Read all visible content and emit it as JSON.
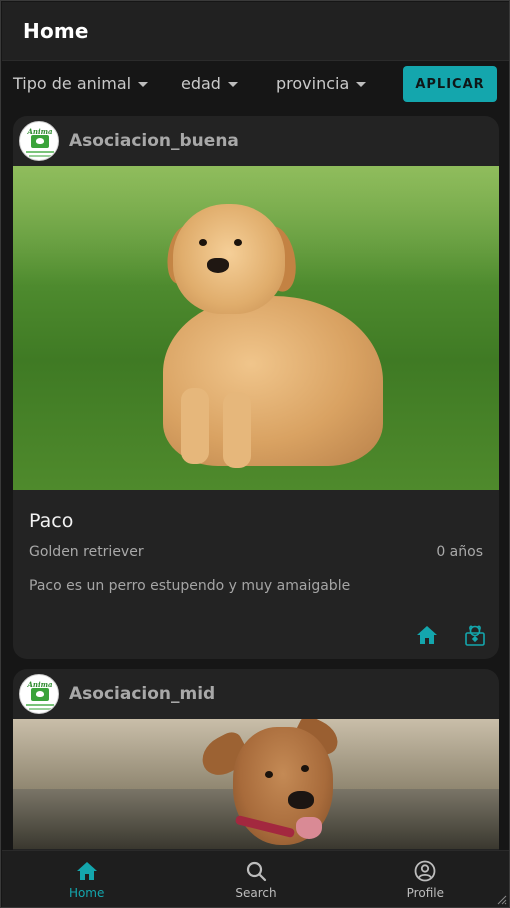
{
  "appbar": {
    "title": "Home"
  },
  "filters": {
    "animal_type": "Tipo de animal",
    "age": "edad",
    "province": "provincia",
    "apply_label": "APLICAR"
  },
  "cards": [
    {
      "org": "Asociacion_buena",
      "pet_name": "Paco",
      "breed": "Golden retriever",
      "age": "0 años",
      "description": "Paco es un perro estupendo y muy amaigable"
    },
    {
      "org": "Asociacion_mid"
    }
  ],
  "avatar_brand": "Anima",
  "bottom_nav": [
    {
      "label": "Home",
      "icon": "home-icon",
      "active": true
    },
    {
      "label": "Search",
      "icon": "search-icon",
      "active": false
    },
    {
      "label": "Profile",
      "icon": "profile-icon",
      "active": false
    }
  ],
  "colors": {
    "accent": "#14a6ad",
    "background": "#161616",
    "card": "#232323",
    "appbar": "#212121"
  }
}
